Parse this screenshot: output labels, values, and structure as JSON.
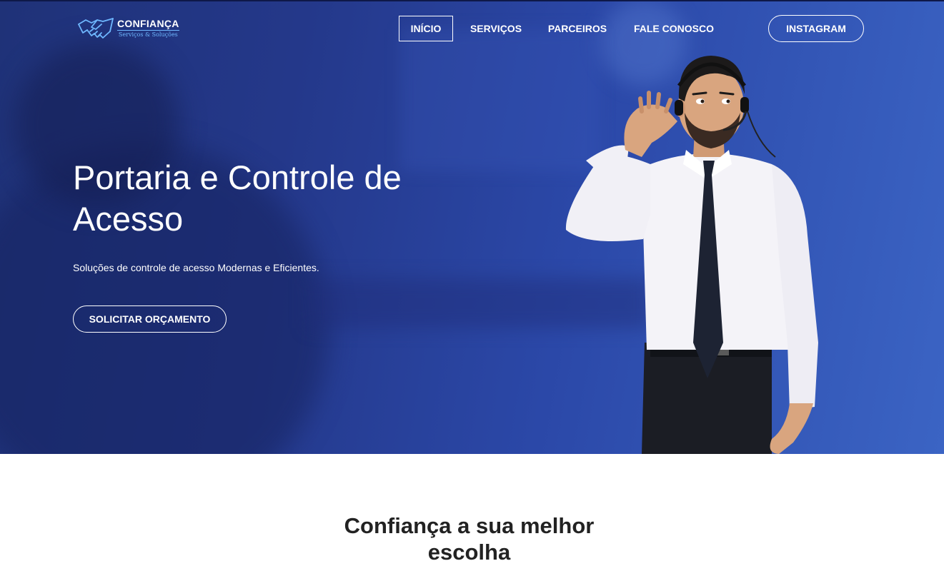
{
  "brand": {
    "name": "CONFIANÇA",
    "tagline": "Serviços & Soluções",
    "logo_icon": "handshake-icon",
    "logo_color": "#6fb8ff"
  },
  "nav": {
    "items": [
      {
        "label": "INÍCIO",
        "active": true
      },
      {
        "label": "SERVIÇOS",
        "active": false
      },
      {
        "label": "PARCEIROS",
        "active": false
      },
      {
        "label": "FALE CONOSCO",
        "active": false
      }
    ],
    "cta_label": "INSTAGRAM"
  },
  "hero": {
    "title_line1": "Portaria e Controle de",
    "title_line2": "Acesso",
    "subtitle": "Soluções de controle de acesso Modernas e Eficientes.",
    "button_label": "SOLICITAR ORÇAMENTO",
    "image": "man-with-headset-listening",
    "bg_color_start": "#1f3278",
    "bg_color_end": "#3b64c4"
  },
  "section": {
    "title_line1": "Confiança a sua melhor",
    "title_line2": "escolha"
  }
}
